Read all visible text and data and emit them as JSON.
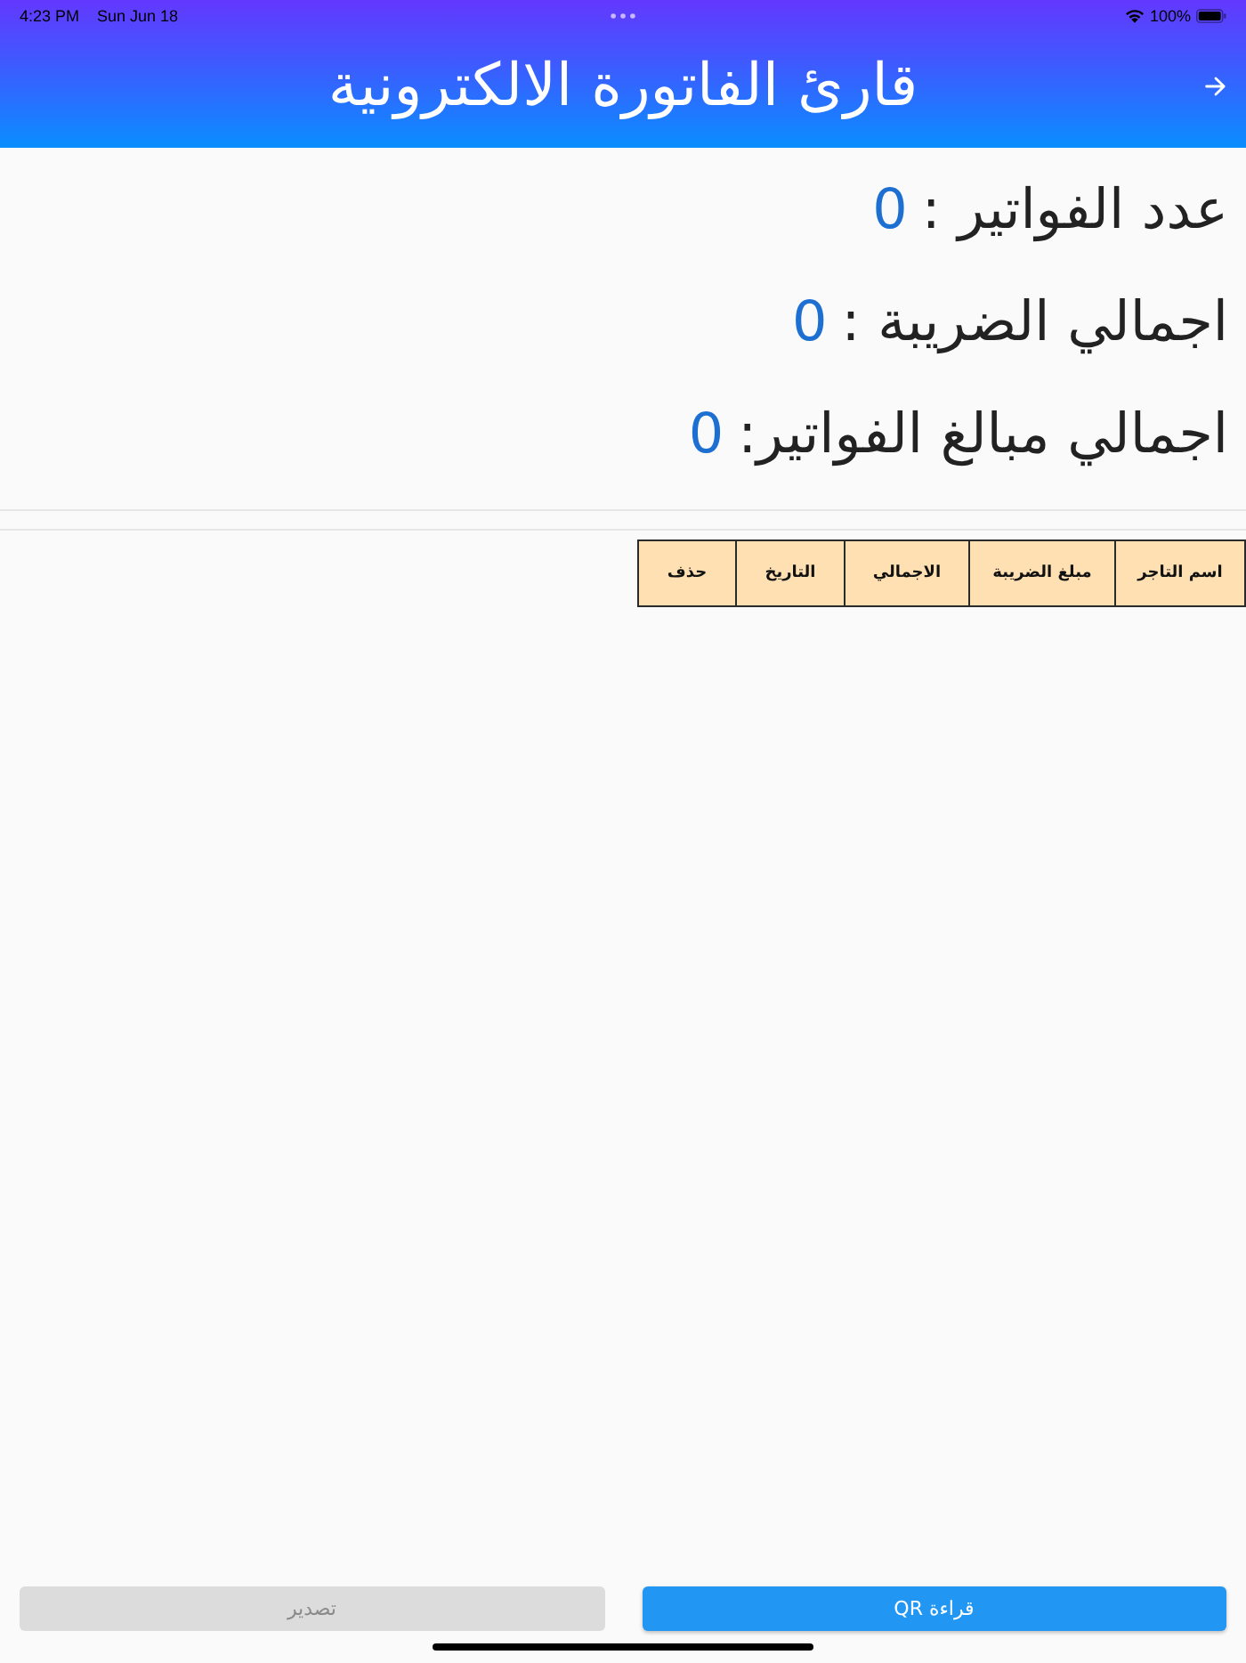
{
  "status_bar": {
    "time": "4:23 PM",
    "date": "Sun Jun 18",
    "battery_text": "100%"
  },
  "header": {
    "title": "قارئ الفاتورة الالكترونية"
  },
  "stats": [
    {
      "label": "عدد الفواتير :",
      "value": "0"
    },
    {
      "label": "اجمالي الضريبة :",
      "value": "0"
    },
    {
      "label": "اجمالي مبالغ الفواتير:",
      "value": "0"
    }
  ],
  "table": {
    "columns": [
      "اسم التاجر",
      "مبلغ الضريبة",
      "الاجمالي",
      "التاريخ",
      "حذف"
    ]
  },
  "buttons": [
    {
      "label": "قراءة QR",
      "disabled": false
    },
    {
      "label": "تصدير",
      "disabled": true
    }
  ]
}
